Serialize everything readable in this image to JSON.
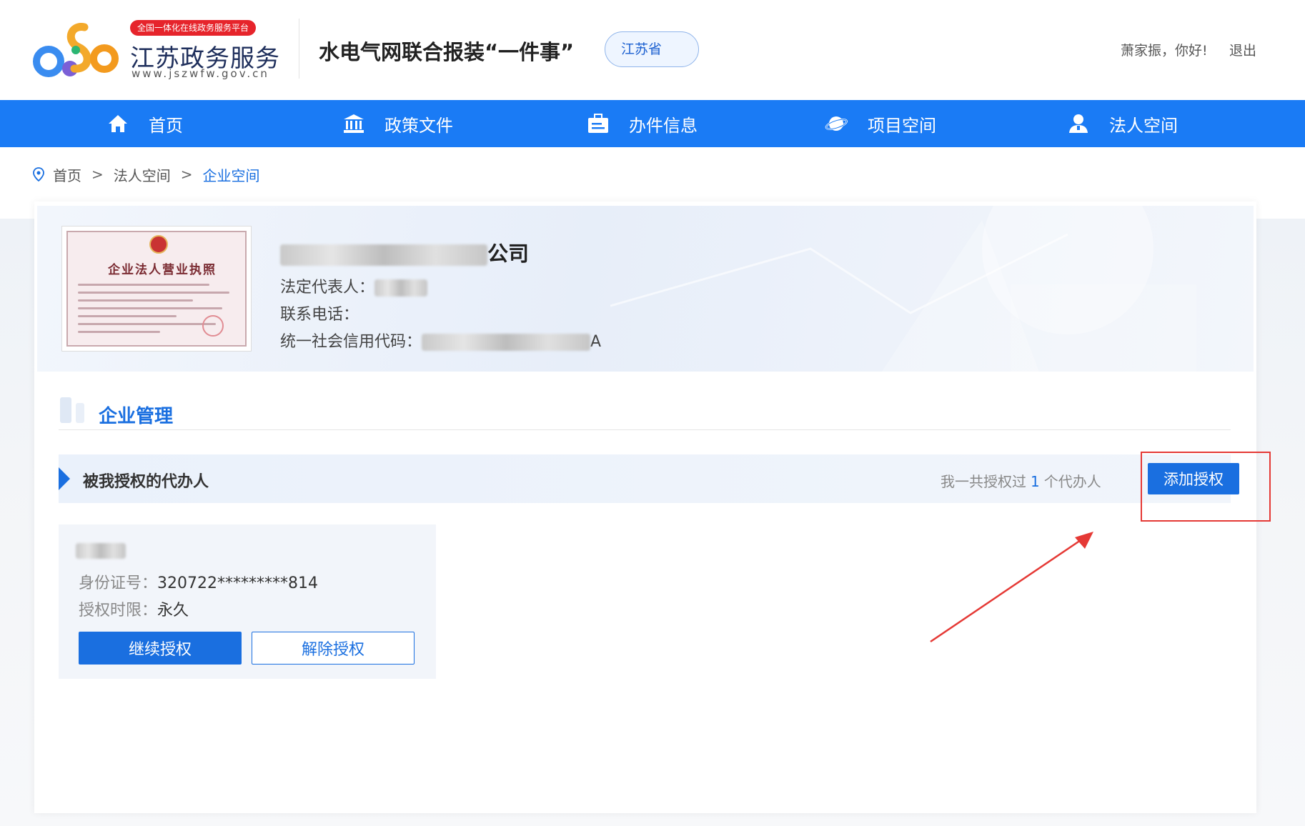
{
  "header": {
    "logo_badge": "全国一体化在线政务服务平台",
    "logo_title": "江苏政务服务",
    "logo_url": "www.jszwfw.gov.cn",
    "site_title": "水电气网联合报装“一件事”",
    "region": "江苏省",
    "greeting": "萧家振，你好!",
    "logout": "退出"
  },
  "nav": {
    "items": [
      {
        "label": "首页",
        "icon": "home-icon"
      },
      {
        "label": "政策文件",
        "icon": "building-icon"
      },
      {
        "label": "办件信息",
        "icon": "briefcase-icon"
      },
      {
        "label": "项目空间",
        "icon": "planet-icon"
      },
      {
        "label": "法人空间",
        "icon": "user-icon"
      }
    ]
  },
  "breadcrumb": {
    "items": [
      "首页",
      "法人空间",
      "企业空间"
    ],
    "separator": ">"
  },
  "company": {
    "license_title": "企业法人营业执照",
    "name_suffix": "公司",
    "legal_rep_label": "法定代表人：",
    "phone_label": "联系电话：",
    "credit_code_label": "统一社会信用代码：",
    "credit_code_suffix": "A"
  },
  "section": {
    "title": "企业管理"
  },
  "authorization": {
    "bar_title": "被我授权的代办人",
    "count_prefix": "我一共授权过",
    "count": "1",
    "count_suffix": "个代办人",
    "add_button": "添加授权"
  },
  "agent": {
    "id_label": "身份证号：",
    "id_value": "320722*********814",
    "term_label": "授权时限：",
    "term_value": "永久",
    "continue_button": "继续授权",
    "revoke_button": "解除授权"
  },
  "colors": {
    "primary": "#1a6fe0",
    "nav": "#1a7bf5",
    "highlight": "#e53935"
  }
}
